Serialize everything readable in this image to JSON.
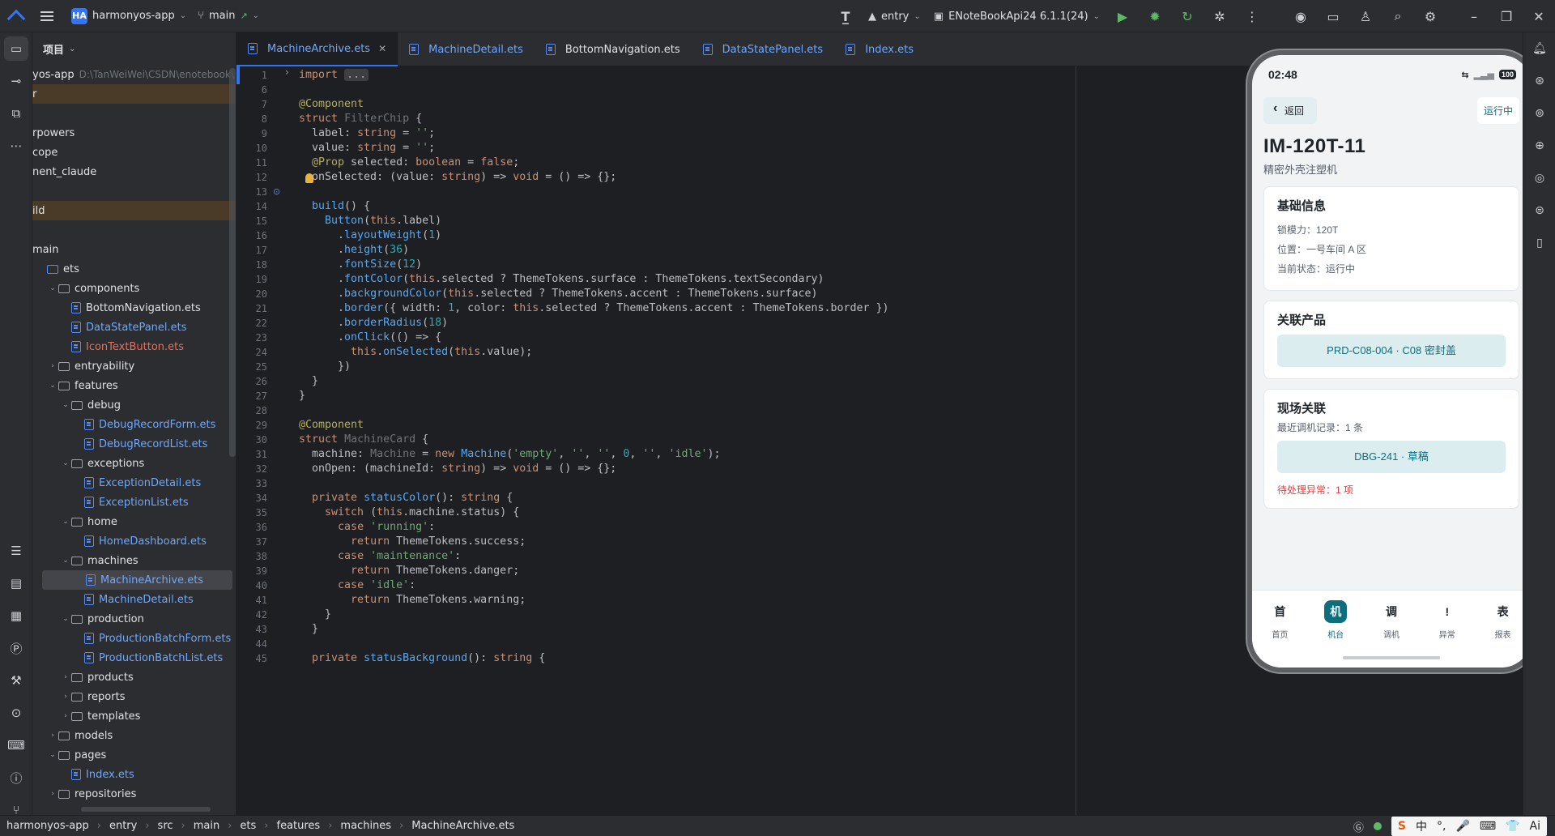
{
  "titlebar": {
    "project_badge": "HA",
    "project_name": "harmonyos-app",
    "branch": "main",
    "branch_arrow": "↗",
    "run_config": "entry",
    "device": "ENoteBookApi24 6.1.1(24)"
  },
  "project_panel": {
    "title": "项目",
    "rows": [
      {
        "text": "yos-app",
        "path": "D:\\TanWeiWei\\CSDN\\enotebook\\",
        "indent": 0
      },
      {
        "text": "r",
        "indent": 0,
        "style": "hl"
      },
      {
        "text": "",
        "indent": 0
      },
      {
        "text": "rpowers",
        "indent": 0
      },
      {
        "text": "cope",
        "indent": 0
      },
      {
        "text": "nent_claude",
        "indent": 0
      },
      {
        "text": "",
        "indent": 0
      },
      {
        "text": "ild",
        "indent": 0,
        "style": "hl"
      },
      {
        "text": "",
        "indent": 0
      },
      {
        "text": "main",
        "indent": 0
      },
      {
        "text": "ets",
        "indent": 1,
        "folder": "blue"
      },
      {
        "text": "components",
        "indent": 1,
        "folder": "plain",
        "twisty": "open"
      },
      {
        "text": "BottomNavigation.ets",
        "indent": 3,
        "file": "plain"
      },
      {
        "text": "DataStatePanel.ets",
        "indent": 3,
        "file": "blue"
      },
      {
        "text": "IconTextButton.ets",
        "indent": 3,
        "file": "red"
      },
      {
        "text": "entryability",
        "indent": 1,
        "folder": "plain",
        "twisty": "closed"
      },
      {
        "text": "features",
        "indent": 1,
        "folder": "plain",
        "twisty": "open"
      },
      {
        "text": "debug",
        "indent": 2,
        "folder": "plain",
        "twisty": "open"
      },
      {
        "text": "DebugRecordForm.ets",
        "indent": 4,
        "file": "blue"
      },
      {
        "text": "DebugRecordList.ets",
        "indent": 4,
        "file": "blue"
      },
      {
        "text": "exceptions",
        "indent": 2,
        "folder": "plain",
        "twisty": "open"
      },
      {
        "text": "ExceptionDetail.ets",
        "indent": 4,
        "file": "blue"
      },
      {
        "text": "ExceptionList.ets",
        "indent": 4,
        "file": "blue"
      },
      {
        "text": "home",
        "indent": 2,
        "folder": "plain",
        "twisty": "open"
      },
      {
        "text": "HomeDashboard.ets",
        "indent": 4,
        "file": "blue"
      },
      {
        "text": "machines",
        "indent": 2,
        "folder": "plain",
        "twisty": "open"
      },
      {
        "text": "MachineArchive.ets",
        "indent": 4,
        "file": "blue",
        "style": "sel"
      },
      {
        "text": "MachineDetail.ets",
        "indent": 4,
        "file": "blue"
      },
      {
        "text": "production",
        "indent": 2,
        "folder": "plain",
        "twisty": "open"
      },
      {
        "text": "ProductionBatchForm.ets",
        "indent": 4,
        "file": "blue"
      },
      {
        "text": "ProductionBatchList.ets",
        "indent": 4,
        "file": "blue"
      },
      {
        "text": "products",
        "indent": 2,
        "folder": "plain",
        "twisty": "closed"
      },
      {
        "text": "reports",
        "indent": 2,
        "folder": "plain",
        "twisty": "closed"
      },
      {
        "text": "templates",
        "indent": 2,
        "folder": "plain",
        "twisty": "closed"
      },
      {
        "text": "models",
        "indent": 1,
        "folder": "plain",
        "twisty": "closed"
      },
      {
        "text": "pages",
        "indent": 1,
        "folder": "plain",
        "twisty": "open"
      },
      {
        "text": "Index.ets",
        "indent": 3,
        "file": "blue"
      },
      {
        "text": "repositories",
        "indent": 1,
        "folder": "plain",
        "twisty": "closed"
      }
    ]
  },
  "tabs": [
    {
      "name": "MachineArchive.ets",
      "active": true,
      "color": "blue"
    },
    {
      "name": "MachineDetail.ets",
      "color": "blue"
    },
    {
      "name": "BottomNavigation.ets",
      "color": "plain"
    },
    {
      "name": "DataStatePanel.ets",
      "color": "blue"
    },
    {
      "name": "Index.ets",
      "color": "blue"
    }
  ],
  "editor": {
    "lines": [
      {
        "n": "1",
        "html": "<span class=\"k\">import</span> <span class=\"fold\">...</span>"
      },
      {
        "n": "6",
        "html": ""
      },
      {
        "n": "7",
        "html": "<span class=\"an\">@Component</span>"
      },
      {
        "n": "8",
        "html": "<span class=\"k\">struct</span> <span class=\"ty\">FilterChip</span> {"
      },
      {
        "n": "9",
        "html": "  label: <span class=\"k\">string</span> = <span class=\"st\">''</span>;"
      },
      {
        "n": "10",
        "html": "  value: <span class=\"k\">string</span> = <span class=\"st\">''</span>;"
      },
      {
        "n": "11",
        "html": "  <span class=\"an\">@Prop</span> selected: <span class=\"k\">boolean</span> = <span class=\"k\">false</span>;"
      },
      {
        "n": "12",
        "html": "  onSelected: (value: <span class=\"k\">string</span>) => <span class=\"k\">void</span> = () => {};"
      },
      {
        "n": "13",
        "html": ""
      },
      {
        "n": "14",
        "html": "  <span class=\"fn\">build</span>() {"
      },
      {
        "n": "15",
        "html": "    <span class=\"fn\">Button</span>(<span class=\"k\">this</span>.label)"
      },
      {
        "n": "16",
        "html": "      .<span class=\"fn\">layoutWeight</span>(<span class=\"nu\">1</span>)"
      },
      {
        "n": "17",
        "html": "      .<span class=\"fn\">height</span>(<span class=\"nu\">36</span>)"
      },
      {
        "n": "18",
        "html": "      .<span class=\"fn\">fontSize</span>(<span class=\"nu\">12</span>)"
      },
      {
        "n": "19",
        "html": "      .<span class=\"fn\">fontColor</span>(<span class=\"k\">this</span>.selected ? ThemeTokens.surface : ThemeTokens.textSecondary)"
      },
      {
        "n": "20",
        "html": "      .<span class=\"fn\">backgroundColor</span>(<span class=\"k\">this</span>.selected ? ThemeTokens.accent : ThemeTokens.surface)"
      },
      {
        "n": "21",
        "html": "      .<span class=\"fn\">border</span>({ width: <span class=\"nu\">1</span>, color: <span class=\"k\">this</span>.selected ? ThemeTokens.accent : ThemeTokens.border })"
      },
      {
        "n": "22",
        "html": "      .<span class=\"fn\">borderRadius</span>(<span class=\"nu\">18</span>)"
      },
      {
        "n": "23",
        "html": "      .<span class=\"fn\">onClick</span>(() => {"
      },
      {
        "n": "24",
        "html": "        <span class=\"k\">this</span>.<span class=\"fn\">onSelected</span>(<span class=\"k\">this</span>.value);"
      },
      {
        "n": "25",
        "html": "      })"
      },
      {
        "n": "26",
        "html": "  }"
      },
      {
        "n": "27",
        "html": "}"
      },
      {
        "n": "28",
        "html": ""
      },
      {
        "n": "29",
        "html": "<span class=\"an\">@Component</span>"
      },
      {
        "n": "30",
        "html": "<span class=\"k\">struct</span> <span class=\"ty\">MachineCard</span> {"
      },
      {
        "n": "31",
        "html": "  machine: <span class=\"ty\">Machine</span> = <span class=\"k\">new</span> <span class=\"fn\">Machine</span>(<span class=\"st\">'empty'</span>, <span class=\"st\">''</span>, <span class=\"st\">''</span>, <span class=\"nu\">0</span>, <span class=\"st\">''</span>, <span class=\"st\">'idle'</span>);"
      },
      {
        "n": "32",
        "html": "  onOpen: (machineId: <span class=\"k\">string</span>) => <span class=\"k\">void</span> = () => {};"
      },
      {
        "n": "33",
        "html": ""
      },
      {
        "n": "34",
        "html": "  <span class=\"k\">private</span> <span class=\"fn\">statusColor</span>(): <span class=\"k\">string</span> {"
      },
      {
        "n": "35",
        "html": "    <span class=\"k\">switch</span> (<span class=\"k\">this</span>.machine.status) {"
      },
      {
        "n": "36",
        "html": "      <span class=\"k\">case</span> <span class=\"st\">'running'</span>:"
      },
      {
        "n": "37",
        "html": "        <span class=\"k\">return</span> ThemeTokens.success;"
      },
      {
        "n": "38",
        "html": "      <span class=\"k\">case</span> <span class=\"st\">'maintenance'</span>:"
      },
      {
        "n": "39",
        "html": "        <span class=\"k\">return</span> ThemeTokens.danger;"
      },
      {
        "n": "40",
        "html": "      <span class=\"k\">case</span> <span class=\"st\">'idle'</span>:"
      },
      {
        "n": "41",
        "html": "        <span class=\"k\">return</span> ThemeTokens.warning;"
      },
      {
        "n": "42",
        "html": "    }"
      },
      {
        "n": "43",
        "html": "  }"
      },
      {
        "n": "44",
        "html": ""
      },
      {
        "n": "45",
        "html": "  <span class=\"k\">private</span> <span class=\"fn\">statusBackground</span>(): <span class=\"k\">string</span> {"
      }
    ]
  },
  "phone": {
    "time": "02:48",
    "battery": "100",
    "back_label": "返回",
    "status_chip": "运行中",
    "machine_code": "IM-120T-11",
    "machine_name": "精密外壳注塑机",
    "basic_card": {
      "title": "基础信息",
      "clamp_force": "锁模力：120T",
      "location": "位置：一号车间 A 区",
      "current_status": "当前状态：运行中"
    },
    "product_card": {
      "title": "关联产品",
      "product_button": "PRD-C08-004 · C08 密封盖"
    },
    "field_card": {
      "title": "现场关联",
      "recent_debug": "最近调机记录：1 条",
      "debug_button": "DBG-241 · 草稿",
      "pending_exceptions": "待处理异常：1 项"
    },
    "tabbar": [
      {
        "glyph": "首",
        "label": "首页"
      },
      {
        "glyph": "机",
        "label": "机台",
        "active": true
      },
      {
        "glyph": "调",
        "label": "调机"
      },
      {
        "glyph": "!",
        "label": "异常"
      },
      {
        "glyph": "表",
        "label": "报表"
      }
    ]
  },
  "statusbar": {
    "crumbs": [
      "harmonyos-app",
      "entry",
      "src",
      "main",
      "ets",
      "features",
      "machines",
      "MachineArchive.ets"
    ],
    "ime": [
      "中",
      "°,",
      "🎤",
      "⌨",
      "👕",
      "Ai"
    ]
  },
  "colors": {
    "accent": "#3574f0",
    "phone_accent": "#0f6e7c",
    "danger": "#d64040"
  }
}
